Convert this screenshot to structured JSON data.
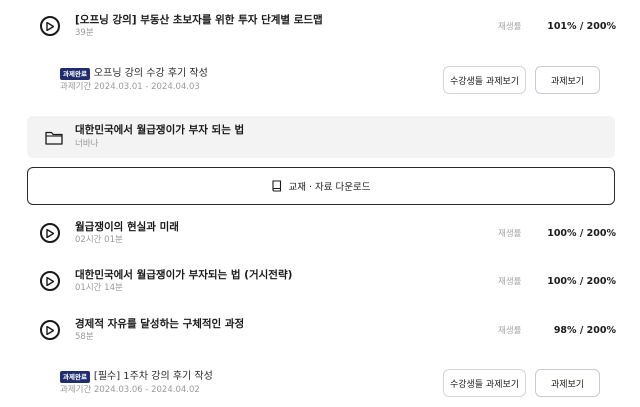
{
  "items": [
    {
      "title": "[오프닝 강의] 부동산 초보자를 위한 투자 단계별 로드맵",
      "duration": "39분",
      "play_label": "재생률",
      "progress": "101% / 200%"
    },
    {
      "title": "월급쟁이의 현실과 미래",
      "duration": "02시간 01분",
      "play_label": "재생률",
      "progress": "100% / 200%"
    },
    {
      "title": "대한민국에서 월급쟁이가 부자되는 법 (거시전략)",
      "duration": "01시간 14분",
      "play_label": "재생률",
      "progress": "100% / 200%"
    },
    {
      "title": "경제적 자유를 달성하는 구체적인 과정",
      "duration": "58분",
      "play_label": "재생률",
      "progress": "98% / 200%"
    }
  ],
  "assignments": [
    {
      "badge": "과제완료",
      "title": "오프닝 강의 수강 후기 작성",
      "period": "과제기간 2024.03.01 - 2024.04.03",
      "review_button": "수강생들 과제보기",
      "homework_button": "과제보기"
    },
    {
      "badge": "과제완료",
      "title": "[필수] 1주차 강의 후기 작성",
      "period": "과제기간 2024.03.06 - 2024.04.02",
      "review_button": "수강생들 과제보기",
      "homework_button": "과제보기"
    }
  ],
  "folder": {
    "title": "대한민국에서 월급쟁이가 부자 되는 법",
    "author": "너바나"
  },
  "download": {
    "label": "교재 · 자료 다운로드"
  },
  "icons": {
    "play": "play-circle-icon",
    "folder": "folder-icon",
    "book": "book-icon"
  },
  "colors": {
    "badge_bg": "#1f2d6e",
    "folder_bg": "#f3f3f3"
  }
}
